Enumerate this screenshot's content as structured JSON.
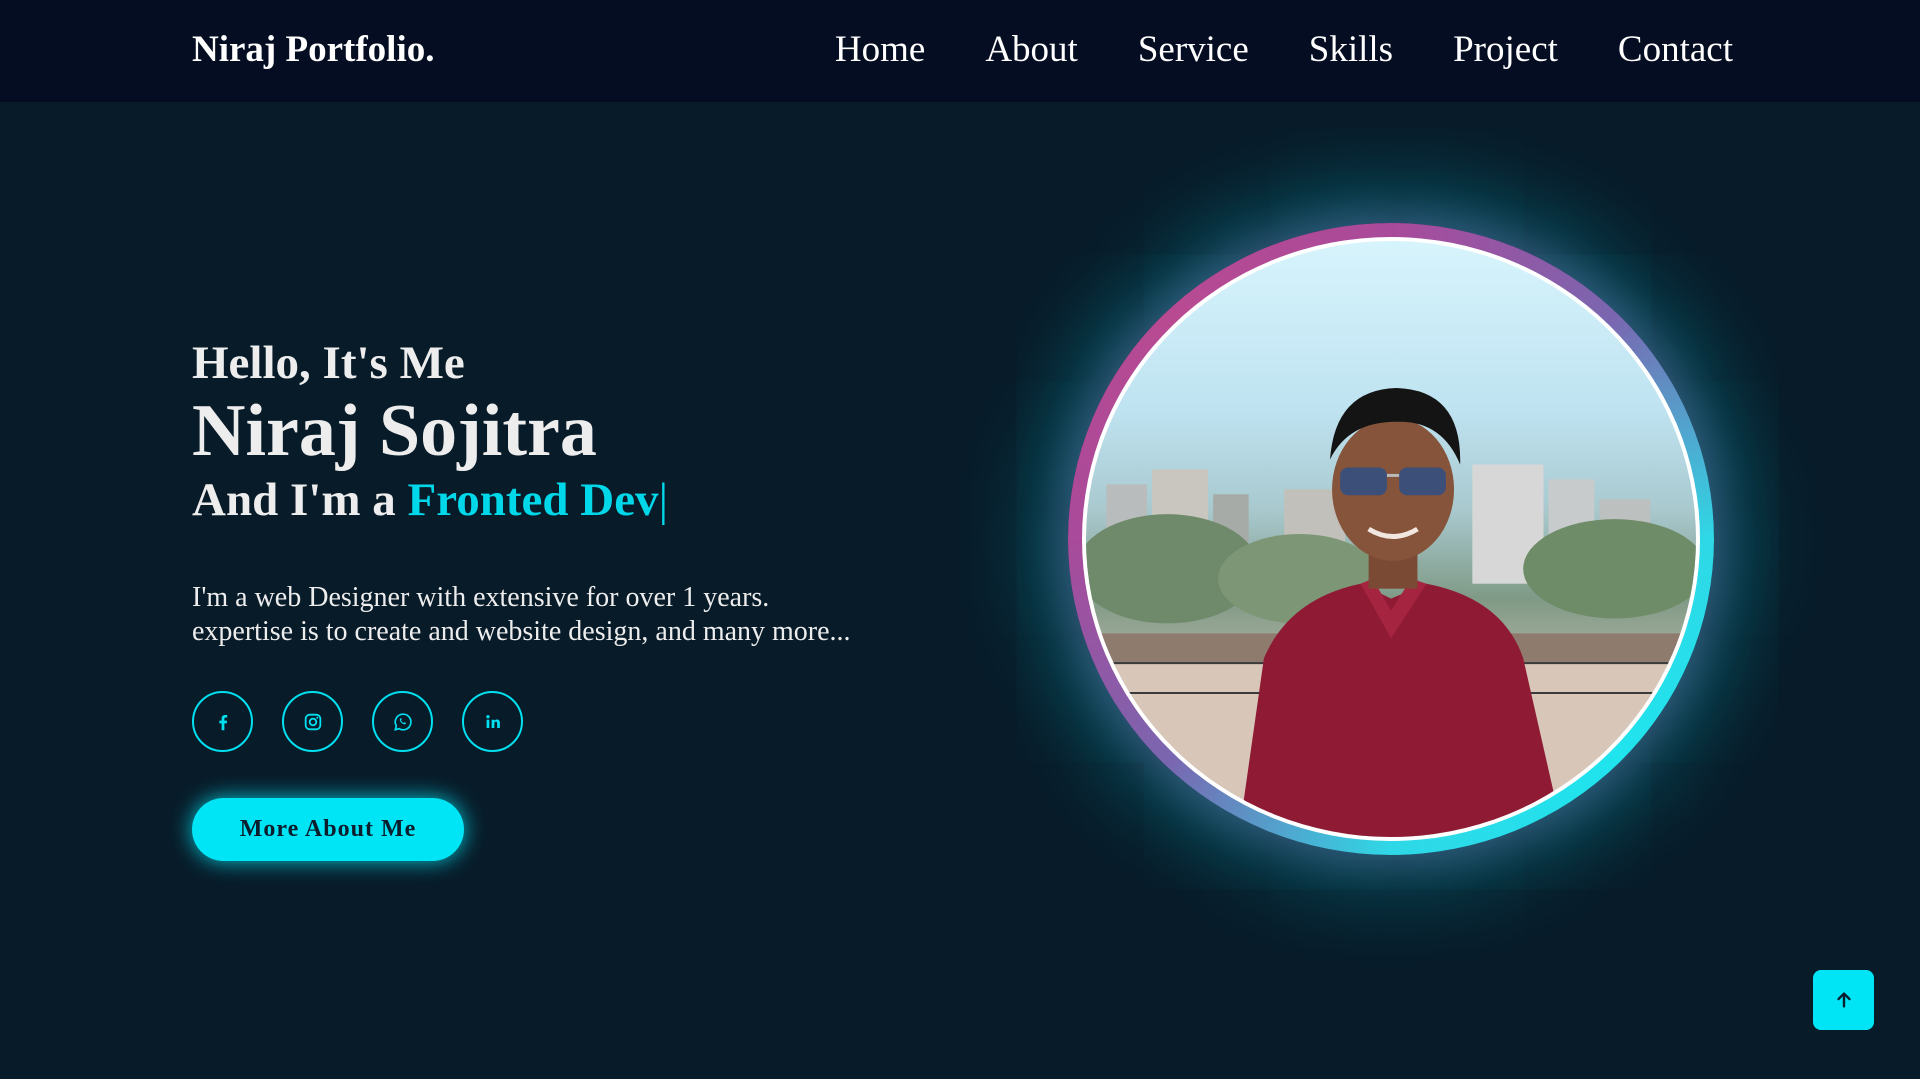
{
  "header": {
    "logo": "Niraj Portfolio.",
    "nav": [
      {
        "label": "Home"
      },
      {
        "label": "About"
      },
      {
        "label": "Service"
      },
      {
        "label": "Skills"
      },
      {
        "label": "Project"
      },
      {
        "label": "Contact"
      }
    ]
  },
  "hero": {
    "greeting": "Hello, It's Me",
    "name": "Niraj Sojitra",
    "role_prefix": "And I'm a ",
    "role_typed": "Fronted Dev",
    "role_cursor": "|",
    "description": [
      "I'm a web Designer with extensive for over 1 years.",
      "expertise is to create and website design, and many more..."
    ],
    "socials": [
      {
        "icon": "facebook-icon"
      },
      {
        "icon": "instagram-icon"
      },
      {
        "icon": "whatsapp-icon"
      },
      {
        "icon": "linkedin-icon"
      }
    ],
    "cta_label": "More About Me"
  },
  "scroll_top": {
    "icon": "arrow-up-icon"
  },
  "colors": {
    "background": "#081b29",
    "navbar": "#050d22",
    "accent": "#00e5f5",
    "text": "#ededed"
  }
}
